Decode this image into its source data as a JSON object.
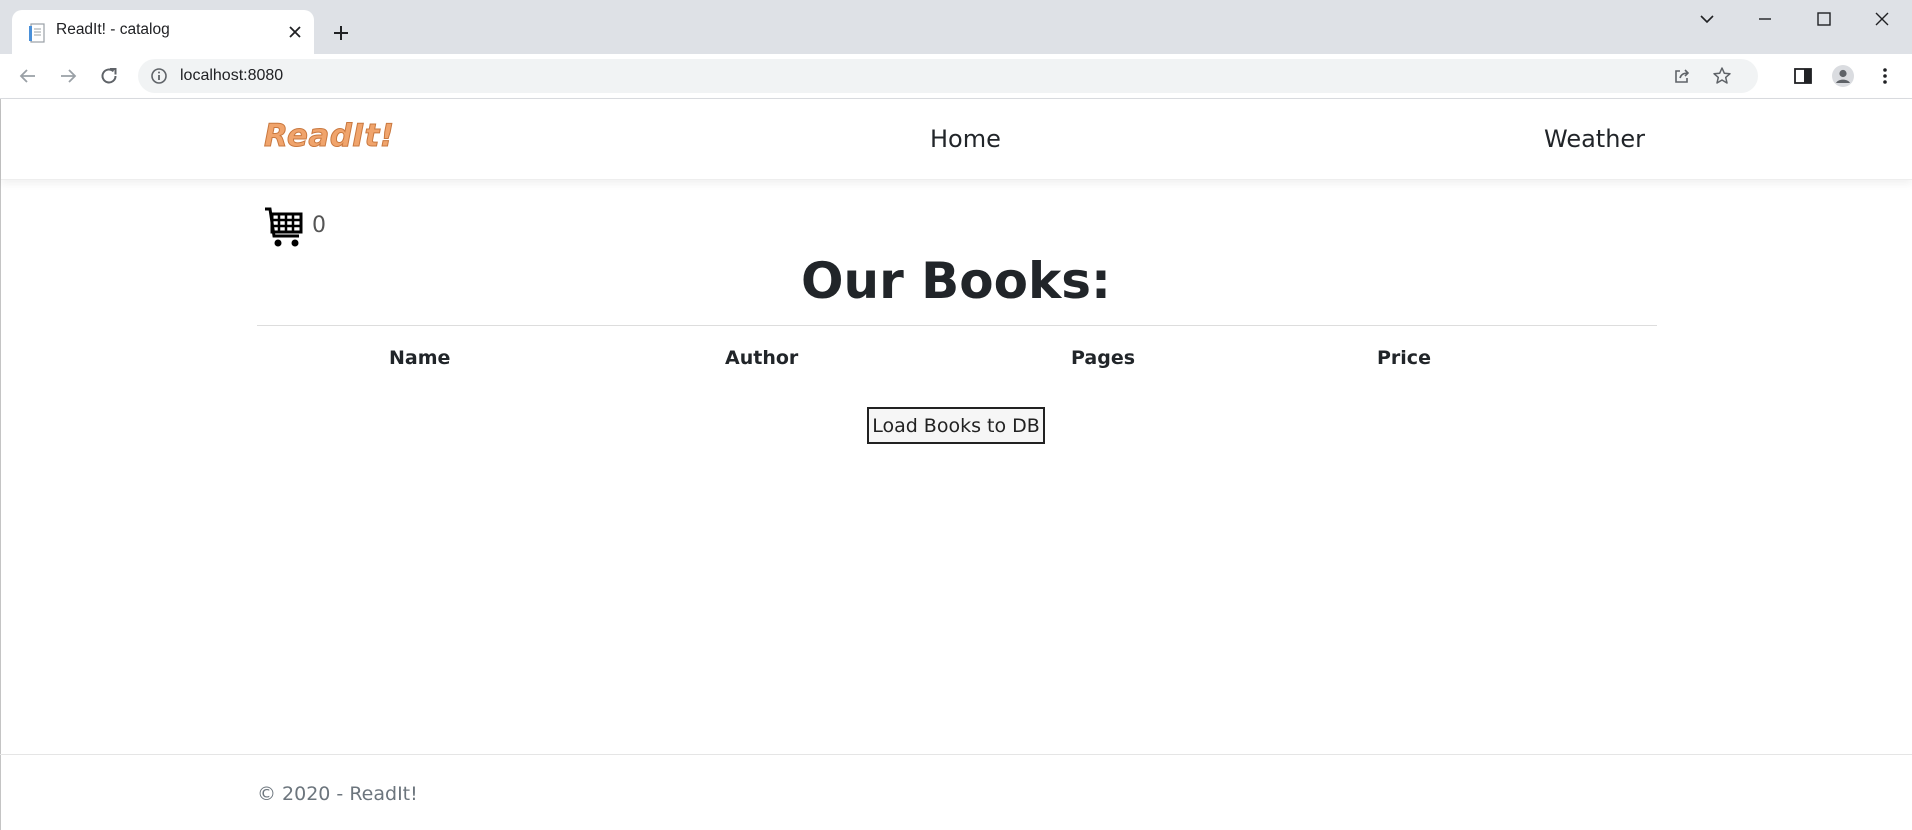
{
  "browser": {
    "tab_title": "ReadIt! - catalog",
    "url": "localhost:8080"
  },
  "navbar": {
    "brand": "ReadIt!",
    "links": [
      "Home",
      "Weather"
    ]
  },
  "cart": {
    "count": "0"
  },
  "catalog": {
    "heading": "Our Books:",
    "columns": [
      "Name",
      "Author",
      "Pages",
      "Price"
    ],
    "load_button": "Load Books to DB"
  },
  "footer": {
    "text": "© 2020 - ReadIt!"
  },
  "colors": {
    "brand": "#f0a46c",
    "chrome_bg": "#dee1e6",
    "text": "#212529"
  },
  "icons": [
    "document-favicon-icon",
    "close-icon",
    "plus-icon",
    "chevron-down-icon",
    "minimize-icon",
    "maximize-icon",
    "window-close-icon",
    "back-arrow-icon",
    "forward-arrow-icon",
    "reload-icon",
    "info-icon",
    "share-icon",
    "star-icon",
    "side-panel-icon",
    "profile-icon",
    "more-vert-icon",
    "shopping-cart-icon"
  ]
}
